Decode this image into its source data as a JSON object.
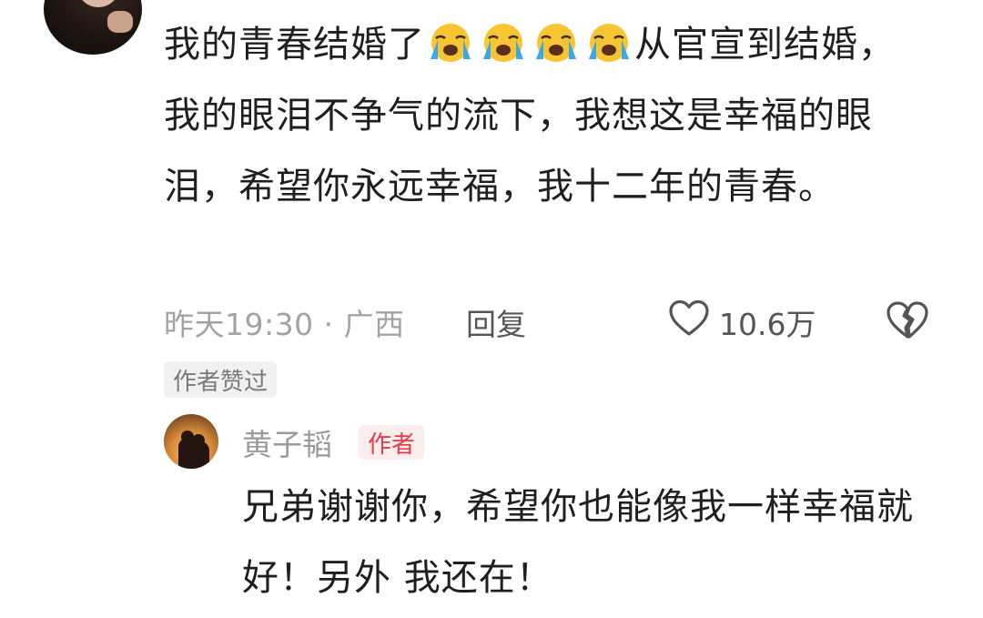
{
  "comment": {
    "text_before_emoji": "我的青春结婚了",
    "emojis": [
      "crying-emoji",
      "crying-emoji",
      "crying-emoji",
      "crying-emoji"
    ],
    "text_after_emoji": "从官宣到结婚，我的眼泪不争气的流下，我想这是幸福的眼泪，希望你永远幸福，我十二年的青春。",
    "time_location": "昨天19:30 · 广西",
    "reply_label": "回复",
    "like_count": "10.6万",
    "author_liked_tag": "作者赞过"
  },
  "reply": {
    "username": "黄子韬",
    "author_badge": "作者",
    "text": "兄弟谢谢你，希望你也能像我一样幸福就好！另外 我还在！"
  },
  "colors": {
    "accent_red": "#e8394b",
    "meta_gray": "#a3a3a3",
    "emoji_yellow": "#f7c531",
    "emoji_tear": "#3aa7e6"
  }
}
